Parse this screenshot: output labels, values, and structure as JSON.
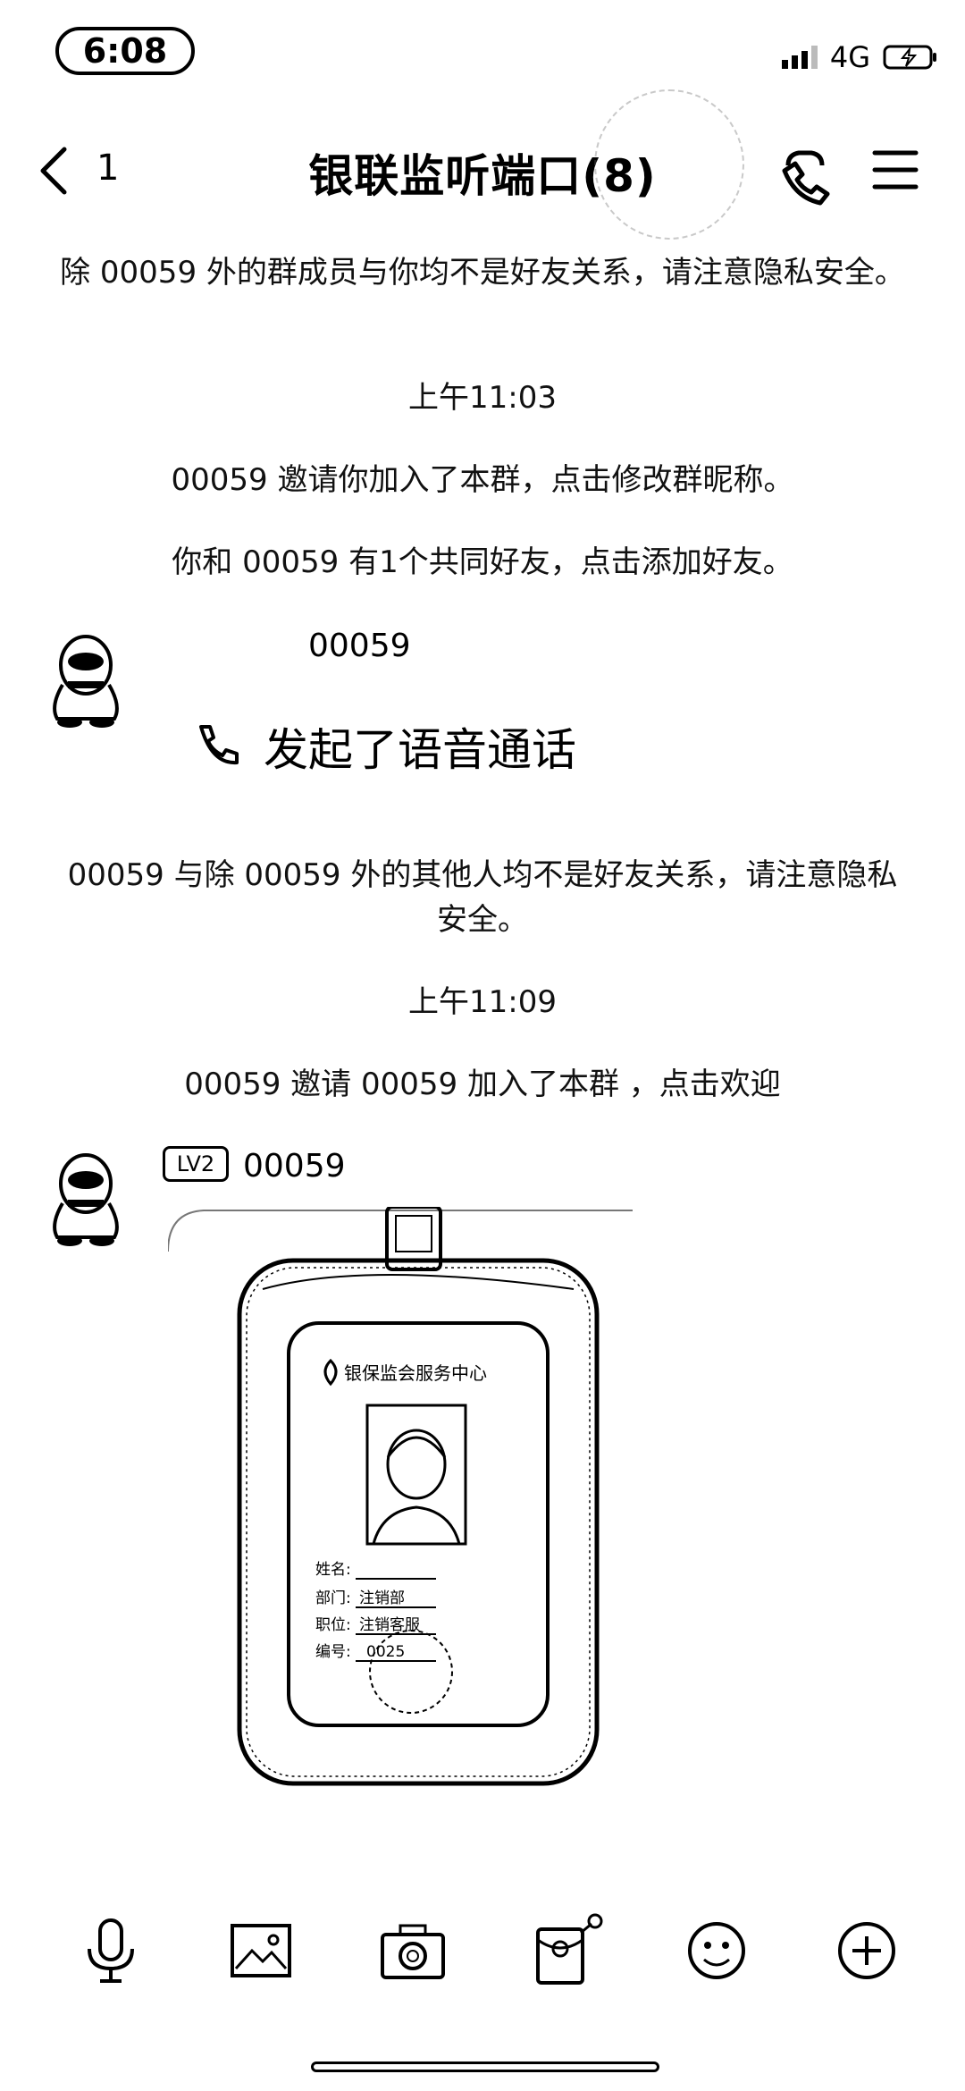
{
  "status": {
    "time": "6:08",
    "network": "4G"
  },
  "nav": {
    "back_count": "1",
    "title": "银联监听端口(8)"
  },
  "messages": {
    "sys1": "除 00059 外的群成员与你均不是好友关系，请注意隐私安全。",
    "time1": "上午11:03",
    "sys2": "00059 邀请你加入了本群，点击修改群昵称。",
    "sys3": "你和 00059 有1个共同好友，点击添加好友。",
    "sender1": "00059",
    "call_text": "发起了语音通话",
    "sys4": "00059 与除 00059 外的其他人均不是好友关系，请注意隐私安全。",
    "time2": "上午11:09",
    "sys5": "00059 邀请 00059  加入了本群 ，点击欢迎",
    "sender2": "00059",
    "badge": "LV2"
  },
  "badge_card": {
    "org": "银保监会服务中心",
    "name_label": "姓名:",
    "dept_label": "部门:",
    "dept_value": "注销部",
    "position_label": "职位:",
    "position_value": "注销客服",
    "id_label": "编号:",
    "id_value": "0025"
  },
  "toolbar": [
    "microphone-icon",
    "image-icon",
    "camera-icon",
    "red-packet-icon",
    "emoji-icon",
    "plus-icon"
  ]
}
